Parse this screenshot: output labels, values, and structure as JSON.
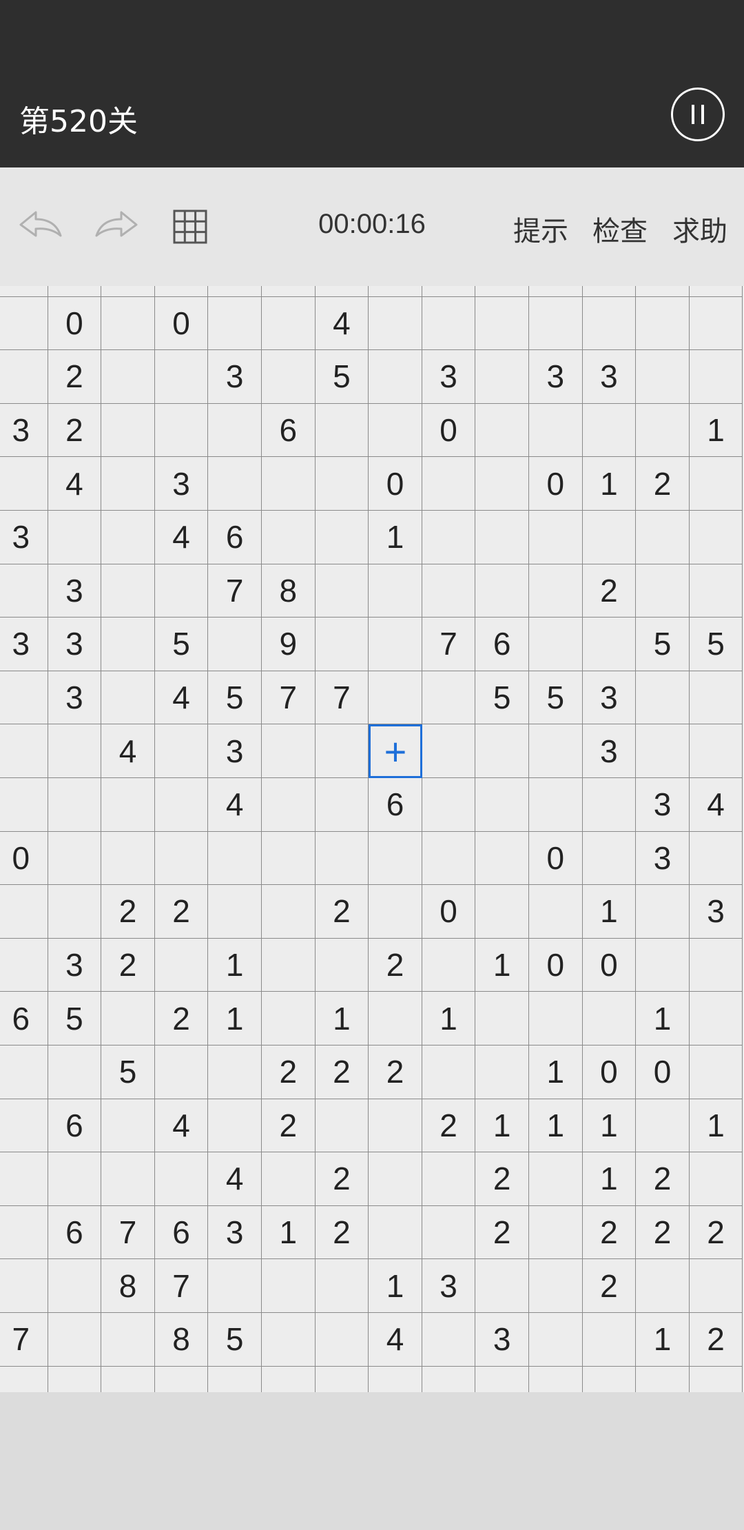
{
  "header": {
    "level_title": "第520关"
  },
  "toolbar": {
    "timer": "00:00:16",
    "hint": "提示",
    "check": "检查",
    "help": "求助"
  },
  "icons": {
    "undo": "undo-arrow-icon",
    "redo": "redo-arrow-icon",
    "grid": "grid-icon",
    "pause": "pause-icon",
    "cursor": "plus-icon"
  },
  "colors": {
    "topbar": "#2e2e2e",
    "toolbar": "#e6e6e6",
    "board": "#ededed",
    "selection": "#1e6fd9"
  },
  "board": {
    "selected": {
      "row": 9,
      "col": 7,
      "symbol": "+"
    },
    "rows": [
      [
        "",
        "",
        "",
        "",
        "",
        "",
        "",
        "",
        "",
        "",
        "",
        "",
        "",
        ""
      ],
      [
        "",
        "0",
        "",
        "0",
        "",
        "",
        "4",
        "",
        "",
        "",
        "",
        "",
        "",
        ""
      ],
      [
        "",
        "2",
        "",
        "",
        "3",
        "",
        "5",
        "",
        "3",
        "",
        "3",
        "3",
        "",
        ""
      ],
      [
        "3",
        "2",
        "",
        "",
        "",
        "6",
        "",
        "",
        "0",
        "",
        "",
        "",
        "",
        "1"
      ],
      [
        "",
        "4",
        "",
        "3",
        "",
        "",
        "",
        "0",
        "",
        "",
        "0",
        "1",
        "2",
        ""
      ],
      [
        "3",
        "",
        "",
        "4",
        "6",
        "",
        "",
        "1",
        "",
        "",
        "",
        "",
        "",
        ""
      ],
      [
        "",
        "3",
        "",
        "",
        "7",
        "8",
        "",
        "",
        "",
        "",
        "",
        "2",
        "",
        ""
      ],
      [
        "3",
        "3",
        "",
        "5",
        "",
        "9",
        "",
        "",
        "7",
        "6",
        "",
        "",
        "5",
        "5"
      ],
      [
        "",
        "3",
        "",
        "4",
        "5",
        "7",
        "7",
        "",
        "",
        "5",
        "5",
        "3",
        "",
        ""
      ],
      [
        "",
        "",
        "4",
        "",
        "3",
        "",
        "",
        "",
        "",
        "",
        "",
        "3",
        "",
        ""
      ],
      [
        "",
        "",
        "",
        "",
        "4",
        "",
        "",
        "6",
        "",
        "",
        "",
        "",
        "3",
        "4"
      ],
      [
        "0",
        "",
        "",
        "",
        "",
        "",
        "",
        "",
        "",
        "",
        "0",
        "",
        "3",
        ""
      ],
      [
        "",
        "",
        "2",
        "2",
        "",
        "",
        "2",
        "",
        "0",
        "",
        "",
        "1",
        "",
        "3"
      ],
      [
        "",
        "3",
        "2",
        "",
        "1",
        "",
        "",
        "2",
        "",
        "1",
        "0",
        "0",
        "",
        ""
      ],
      [
        "6",
        "5",
        "",
        "2",
        "1",
        "",
        "1",
        "",
        "1",
        "",
        "",
        "",
        "1",
        ""
      ],
      [
        "",
        "",
        "5",
        "",
        "",
        "2",
        "2",
        "2",
        "",
        "",
        "1",
        "0",
        "0",
        ""
      ],
      [
        "",
        "6",
        "",
        "4",
        "",
        "2",
        "",
        "",
        "2",
        "1",
        "1",
        "1",
        "",
        "1"
      ],
      [
        "",
        "",
        "",
        "",
        "4",
        "",
        "2",
        "",
        "",
        "2",
        "",
        "1",
        "2",
        ""
      ],
      [
        "",
        "6",
        "7",
        "6",
        "3",
        "1",
        "2",
        "",
        "",
        "2",
        "",
        "2",
        "2",
        "2"
      ],
      [
        "",
        "",
        "8",
        "7",
        "",
        "",
        "",
        "1",
        "3",
        "",
        "",
        "2",
        "",
        ""
      ],
      [
        "7",
        "",
        "",
        "8",
        "5",
        "",
        "",
        "4",
        "",
        "3",
        "",
        "",
        "1",
        "2"
      ],
      [
        "",
        "",
        "",
        "",
        "",
        "",
        "",
        "",
        "",
        "",
        "",
        "",
        "",
        ""
      ]
    ]
  }
}
